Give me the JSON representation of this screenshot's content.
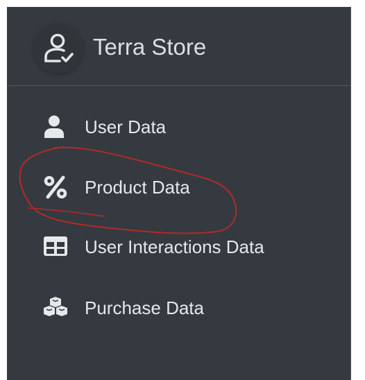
{
  "brand": {
    "title": "Terra Store",
    "icon": "user-check-icon"
  },
  "nav": {
    "items": [
      {
        "label": "User Data",
        "icon": "user-icon"
      },
      {
        "label": "Product Data",
        "icon": "percent-icon"
      },
      {
        "label": "User Interactions Data",
        "icon": "table-icon"
      },
      {
        "label": "Purchase Data",
        "icon": "cubes-icon"
      }
    ]
  },
  "colors": {
    "sidebar_bg": "#343a40",
    "text": "#e6e8ea",
    "annotation": "#b32a2a"
  }
}
